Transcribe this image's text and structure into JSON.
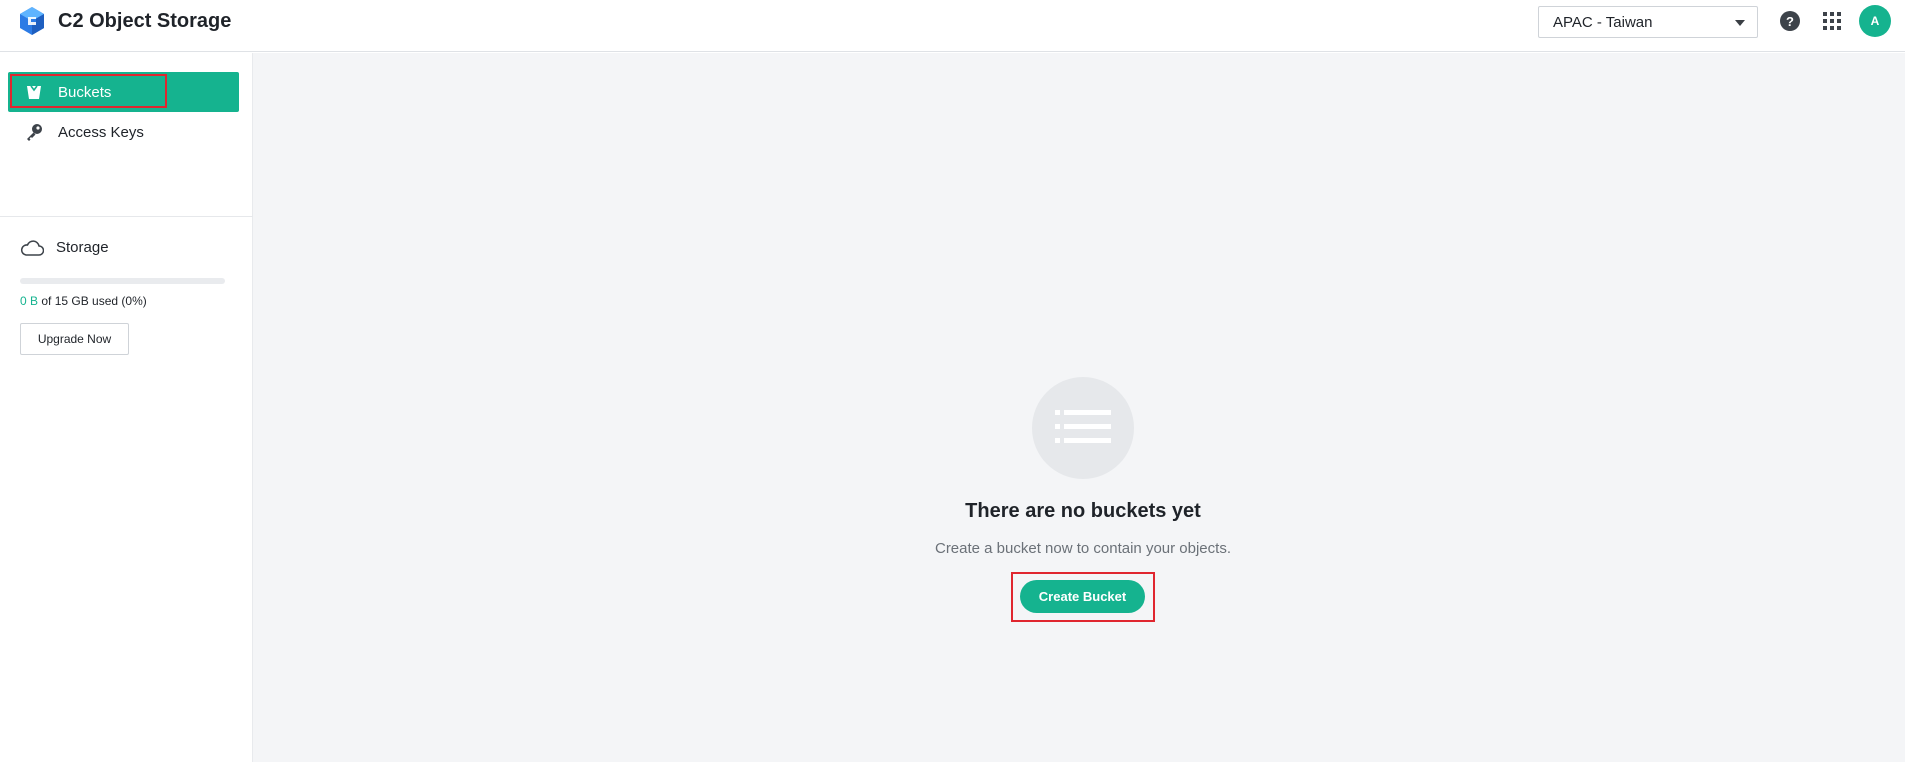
{
  "header": {
    "app_title": "C2 Object Storage",
    "region": {
      "selected": "APAC - Taiwan"
    },
    "help_glyph": "?",
    "avatar_initial": "A"
  },
  "sidebar": {
    "items": [
      {
        "label": "Buckets",
        "icon": "bucket-icon",
        "active": true
      },
      {
        "label": "Access Keys",
        "icon": "key-icon",
        "active": false
      }
    ],
    "storage": {
      "label": "Storage",
      "icon": "cloud-icon",
      "used": "0 B",
      "usage_suffix": " of 15 GB used (0%)",
      "percent_used": 0,
      "upgrade_label": "Upgrade Now"
    }
  },
  "main": {
    "empty_state": {
      "icon": "list-icon",
      "title": "There are no buckets yet",
      "subtitle": "Create a bucket now to contain your objects.",
      "cta_label": "Create Bucket"
    }
  },
  "colors": {
    "accent": "#15b38f",
    "highlight": "#e0262f",
    "main_bg": "#f4f5f7"
  }
}
